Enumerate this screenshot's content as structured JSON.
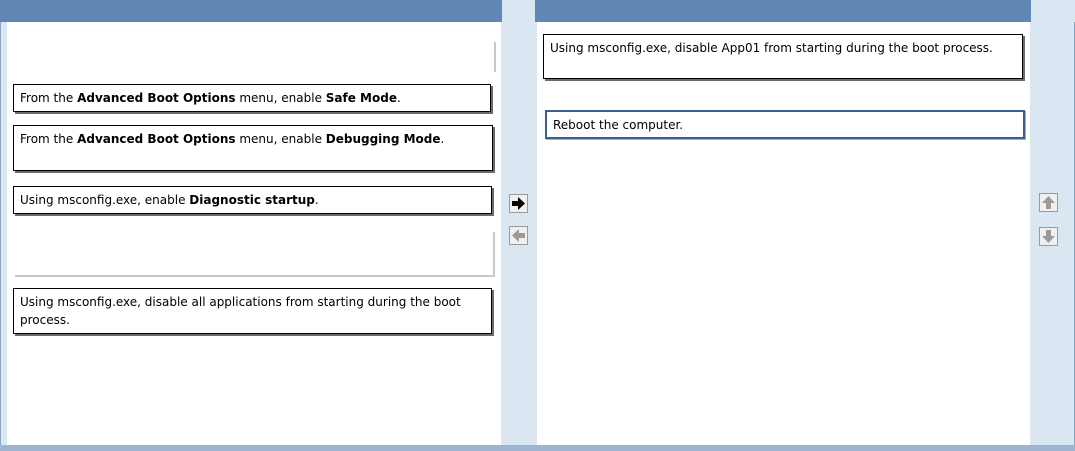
{
  "source_list": {
    "items": [
      {
        "parts": [
          {
            "t": "From the ",
            "b": false
          },
          {
            "t": "Advanced Boot Options",
            "b": true
          },
          {
            "t": " menu, enable ",
            "b": false
          },
          {
            "t": "Safe Mode",
            "b": true
          },
          {
            "t": ".",
            "b": false
          }
        ]
      },
      {
        "parts": [
          {
            "t": "From the ",
            "b": false
          },
          {
            "t": "Advanced Boot Options",
            "b": true
          },
          {
            "t": " menu, enable ",
            "b": false
          },
          {
            "t": "Debugging Mode",
            "b": true
          },
          {
            "t": ".",
            "b": false
          }
        ]
      },
      {
        "parts": [
          {
            "t": "Using msconfig.exe, enable ",
            "b": false
          },
          {
            "t": "Diagnostic startup",
            "b": true
          },
          {
            "t": ".",
            "b": false
          }
        ]
      },
      {
        "parts": [
          {
            "t": "Using msconfig.exe, disable all applications from starting during the boot process.",
            "b": false
          }
        ]
      }
    ]
  },
  "answer_list": {
    "items": [
      {
        "parts": [
          {
            "t": "Using msconfig.exe, disable App01 from starting during the boot process.",
            "b": false
          }
        ]
      },
      {
        "parts": [
          {
            "t": "Reboot the computer.",
            "b": false
          }
        ]
      }
    ]
  },
  "controls": {
    "move_right_icon": "arrow-right-icon",
    "move_left_icon": "arrow-left-icon",
    "move_up_icon": "arrow-up-icon",
    "move_down_icon": "arrow-down-icon"
  },
  "colors": {
    "header": "#5f86b5",
    "background": "#dbe6f3",
    "selected_border": "#3a5f8f"
  }
}
